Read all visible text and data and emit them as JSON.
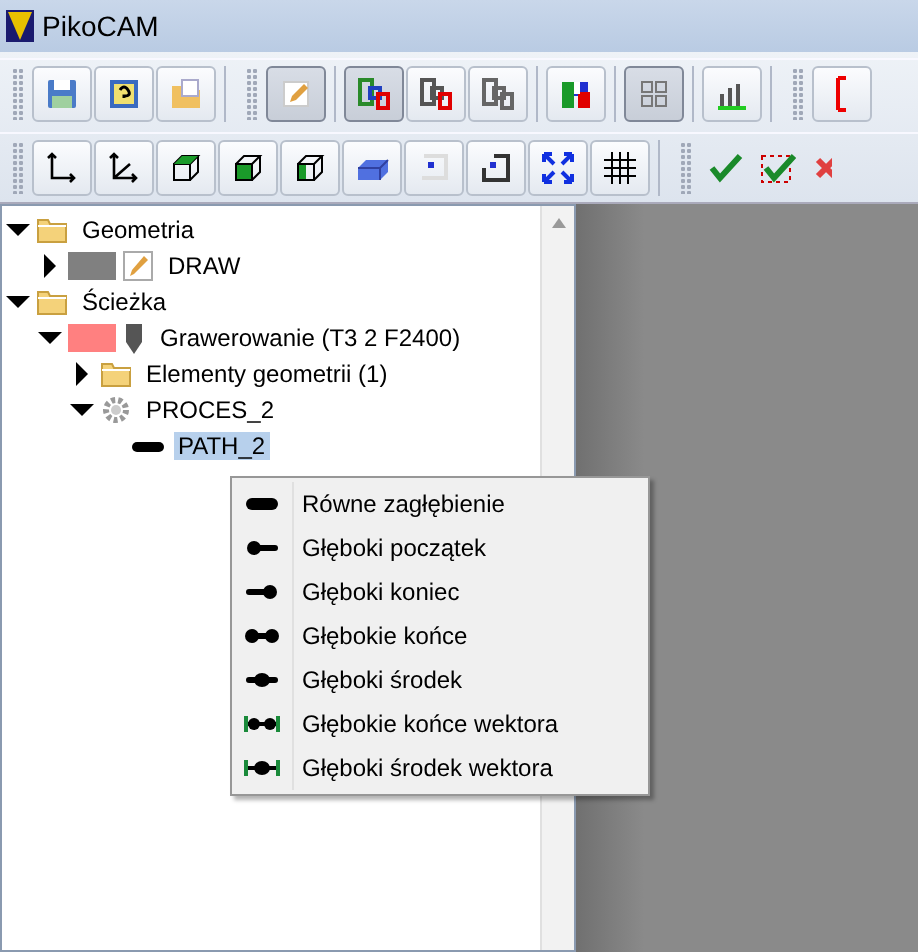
{
  "window": {
    "title": "PikoCAM"
  },
  "toolbar_1": [
    {
      "pressed": false
    },
    {
      "pressed": false
    },
    {
      "pressed": false
    },
    {
      "pressed": true
    },
    {
      "pressed": true
    },
    {
      "pressed": false
    },
    {
      "pressed": false
    },
    {
      "pressed": false
    },
    {
      "pressed": true
    },
    {
      "pressed": false
    },
    {
      "pressed": false
    }
  ],
  "toolbar_2": [
    {
      "pressed": false
    },
    {
      "pressed": false
    },
    {
      "pressed": false
    },
    {
      "pressed": false
    },
    {
      "pressed": false
    },
    {
      "pressed": false
    },
    {
      "pressed": false
    },
    {
      "pressed": false
    },
    {
      "pressed": false
    },
    {
      "pressed": false
    }
  ],
  "tree": [
    {
      "label": "Geometria",
      "kind": "folder",
      "expanded": true,
      "selected": false,
      "children": [
        {
          "label": "DRAW",
          "kind": "layer",
          "color": "#808080",
          "expanded": false,
          "selected": false
        }
      ]
    },
    {
      "label": "Ścieżka",
      "kind": "folder",
      "expanded": true,
      "selected": false,
      "children": [
        {
          "label": "Grawerowanie (T3 2 F2400)",
          "kind": "tool",
          "color": "#ff8080",
          "expanded": true,
          "selected": false,
          "children": [
            {
              "label": "Elementy geometrii (1)",
              "kind": "folder",
              "expanded": false,
              "selected": false
            },
            {
              "label": "PROCES_2",
              "kind": "process",
              "expanded": true,
              "selected": false,
              "children": [
                {
                  "label": "PATH_2",
                  "kind": "path",
                  "selected": true
                }
              ]
            }
          ]
        }
      ]
    }
  ],
  "context_menu": [
    {
      "label": "Równe zagłębienie",
      "kind": "flat"
    },
    {
      "label": "Głęboki początek",
      "kind": "start"
    },
    {
      "label": "Głęboki koniec",
      "kind": "end"
    },
    {
      "label": "Głębokie końce",
      "kind": "ends"
    },
    {
      "label": "Głęboki środek",
      "kind": "middle"
    },
    {
      "label": "Głębokie końce wektora",
      "kind": "vector-ends"
    },
    {
      "label": "Głęboki środek wektora",
      "kind": "vector-middle"
    }
  ]
}
